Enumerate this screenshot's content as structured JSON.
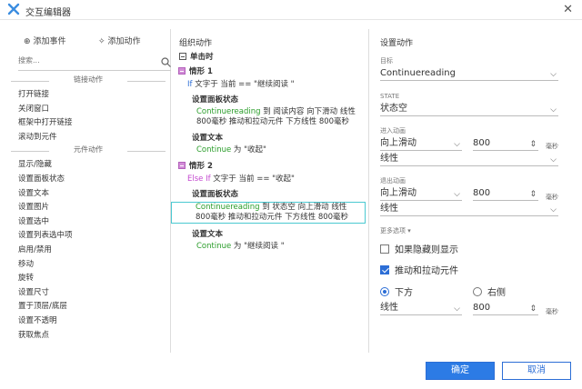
{
  "window": {
    "title": "交互编辑器",
    "close_glyph": "✕"
  },
  "left": {
    "tab_add_event": "添加事件",
    "tab_add_action": "添加动作",
    "search_placeholder": "搜索...",
    "group_links": "链接动作",
    "link_items": [
      "打开链接",
      "关闭窗口",
      "框架中打开链接",
      "滚动到元件"
    ],
    "group_widgets": "元件动作",
    "widget_items": [
      "显示/隐藏",
      "设置面板状态",
      "设置文本",
      "设置图片",
      "设置选中",
      "设置列表选中项",
      "启用/禁用",
      "移动",
      "旋转",
      "设置尺寸",
      "置于顶层/底层",
      "设置不透明",
      "获取焦点"
    ]
  },
  "middle": {
    "header": "组织动作",
    "event": "单击时",
    "case1": {
      "label": "情形 1",
      "cond_kw": "If",
      "cond_text": "文字于 当前 == \"继续阅读 \"",
      "act1": "设置面板状态",
      "act1_target": "Continuereading",
      "act1_l1": " 到 阅读内容 向下滑动 线性",
      "act1_l2": "800毫秒 推动和拉动元件 下方线性 800毫秒",
      "act2": "设置文本",
      "act2_target": "Continue",
      "act2_rest": " 为 \"收起\""
    },
    "case2": {
      "label": "情形 2",
      "cond_kw": "Else If",
      "cond_text": "文字于 当前 == \"收起\"",
      "act1": "设置面板状态",
      "act1_target": "Continuereading",
      "act1_l1": " 到 状态空 向上滑动 线性",
      "act1_l2": "800毫秒 推动和拉动元件 下方线性 800毫秒",
      "act2": "设置文本",
      "act2_target": "Continue",
      "act2_rest": " 为 \"继续阅读 \""
    }
  },
  "right": {
    "header": "设置动作",
    "target_label": "目标",
    "target_value": "Continuereading",
    "state_label": "STATE",
    "state_value": "状态空",
    "enter_label": "进入动画",
    "enter_anim": "向上滑动",
    "enter_ms": "800",
    "enter_unit": "毫秒",
    "enter_ease": "线性",
    "exit_label": "退出动画",
    "exit_anim": "向上滑动",
    "exit_ms": "800",
    "exit_unit": "毫秒",
    "exit_ease": "线性",
    "more_label": "更多选项",
    "hidden_label": "如果隐藏则显示",
    "hidden_checked": false,
    "push_label": "推动和拉动元件",
    "push_checked": true,
    "below_label": "下方",
    "right_label": "右侧",
    "push_ease": "线性",
    "push_ms": "800",
    "push_unit": "毫秒"
  },
  "buttons": {
    "ok": "确定",
    "cancel": "取消"
  },
  "colors": {
    "accent": "#2c7be5",
    "highlight": "#4bc9d1",
    "green": "#2a9d2a",
    "case_purple": "#d28cd7"
  }
}
